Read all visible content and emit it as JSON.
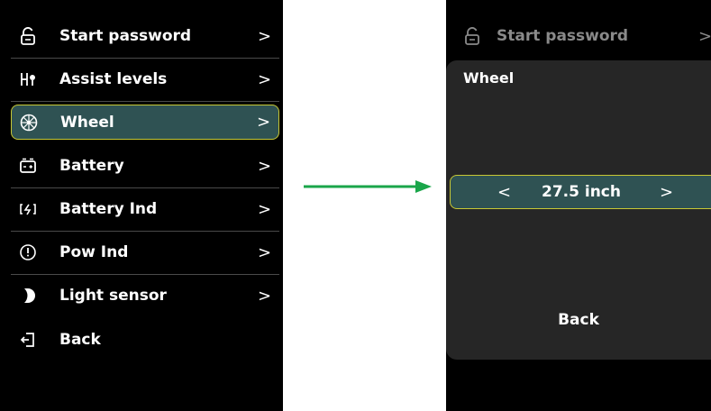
{
  "left_menu": {
    "items": [
      {
        "label": "Start password",
        "icon": "unlock-icon"
      },
      {
        "label": "Assist levels",
        "icon": "assist-levels-icon"
      },
      {
        "label": "Wheel",
        "icon": "wheel-icon",
        "selected": true
      },
      {
        "label": "Battery",
        "icon": "battery-icon"
      },
      {
        "label": "Battery Ind",
        "icon": "battery-indicator-icon"
      },
      {
        "label": "Pow Ind",
        "icon": "power-indicator-icon"
      },
      {
        "label": "Light sensor",
        "icon": "light-sensor-icon"
      }
    ],
    "chevron": ">",
    "back_label": "Back"
  },
  "right_screen": {
    "faded_item_label": "Start password",
    "popup": {
      "title": "Wheel",
      "prev": "<",
      "value": "27.5 inch",
      "next": ">",
      "back_label": "Back"
    }
  },
  "colors": {
    "screen_bg": "#000000",
    "selected_bg": "#2f5253",
    "selected_border": "#c8c834",
    "popup_bg": "#262626",
    "arrow": "#1aa64a"
  }
}
